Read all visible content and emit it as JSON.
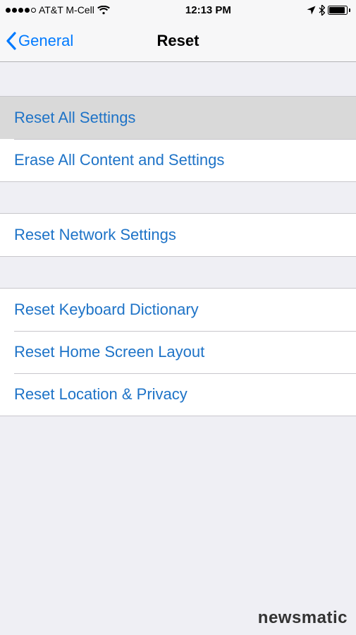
{
  "status": {
    "carrier": "AT&T M-Cell",
    "time": "12:13 PM",
    "signal_filled": 4,
    "signal_total": 5
  },
  "nav": {
    "back_label": "General",
    "title": "Reset"
  },
  "groups": [
    {
      "rows": [
        {
          "key": "reset-all-settings",
          "label": "Reset All Settings",
          "highlighted": true
        },
        {
          "key": "erase-all-content",
          "label": "Erase All Content and Settings",
          "highlighted": false
        }
      ]
    },
    {
      "rows": [
        {
          "key": "reset-network-settings",
          "label": "Reset Network Settings",
          "highlighted": false
        }
      ]
    },
    {
      "rows": [
        {
          "key": "reset-keyboard-dictionary",
          "label": "Reset Keyboard Dictionary",
          "highlighted": false
        },
        {
          "key": "reset-home-screen-layout",
          "label": "Reset Home Screen Layout",
          "highlighted": false
        },
        {
          "key": "reset-location-privacy",
          "label": "Reset Location & Privacy",
          "highlighted": false
        }
      ]
    }
  ],
  "watermark": "newsmatic"
}
